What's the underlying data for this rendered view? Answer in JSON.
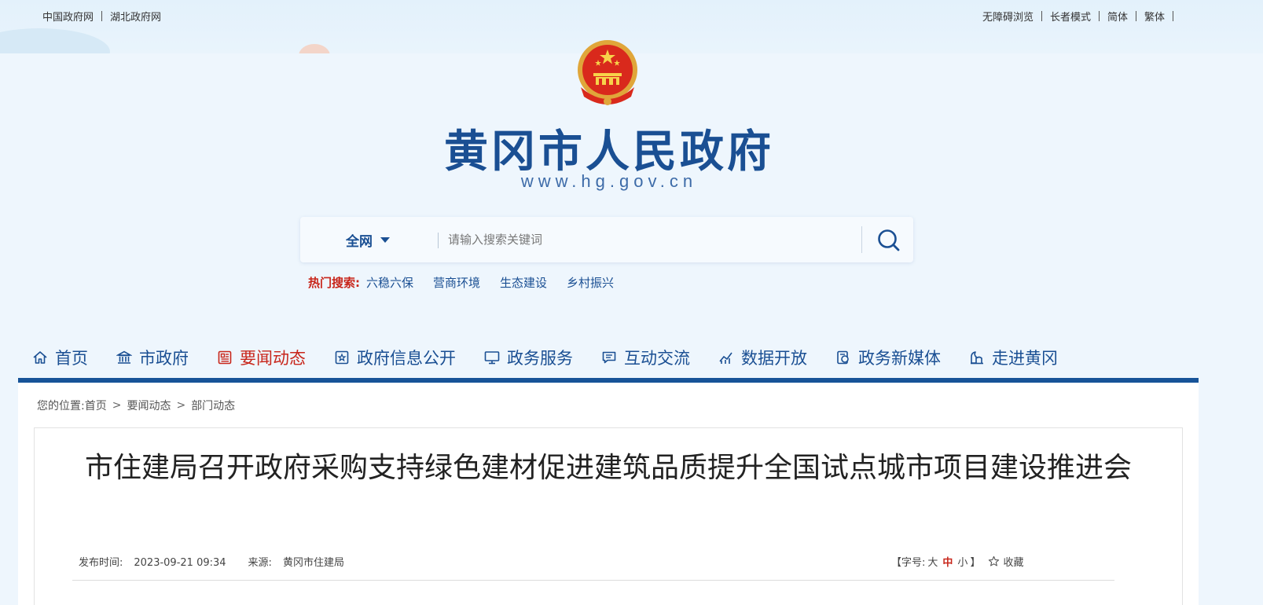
{
  "top": {
    "left_links": [
      "中国政府网",
      "湖北政府网"
    ],
    "right_links": [
      "无障碍浏览",
      "长者模式",
      "简体",
      "繁体"
    ]
  },
  "header": {
    "title": "黄冈市人民政府",
    "url": "www.hg.gov.cn"
  },
  "search": {
    "scope": "全网",
    "placeholder": "请输入搜索关键词",
    "hot_label": "热门搜索:",
    "hot_terms": [
      "六稳六保",
      "营商环境",
      "生态建设",
      "乡村振兴"
    ]
  },
  "nav": {
    "items": [
      {
        "label": "首页",
        "icon": "home-icon"
      },
      {
        "label": "市政府",
        "icon": "building-icon"
      },
      {
        "label": "要闻动态",
        "icon": "news-icon",
        "active": true
      },
      {
        "label": "政府信息公开",
        "icon": "info-icon"
      },
      {
        "label": "政务服务",
        "icon": "monitor-icon"
      },
      {
        "label": "互动交流",
        "icon": "chat-icon"
      },
      {
        "label": "数据开放",
        "icon": "chart-icon"
      },
      {
        "label": "政务新媒体",
        "icon": "media-icon"
      },
      {
        "label": "走进黄冈",
        "icon": "landmark-icon"
      }
    ],
    "active_color": "#c8261b",
    "color": "#1a4f93"
  },
  "breadcrumb": {
    "prefix": "您的位置:",
    "items": [
      "首页",
      "要闻动态",
      "部门动态"
    ]
  },
  "article": {
    "title": "市住建局召开政府采购支持绿色建材促进建筑品质提升全国试点城市项目建设推进会",
    "publish_label": "发布时间:",
    "publish_time": "2023-09-21 09:34",
    "source_label": "来源:",
    "source": "黄冈市住建局",
    "font_size_open": "【字号:",
    "font_sizes": [
      "大",
      "中",
      "小"
    ],
    "font_size_close": "】",
    "favorite": "收藏"
  }
}
